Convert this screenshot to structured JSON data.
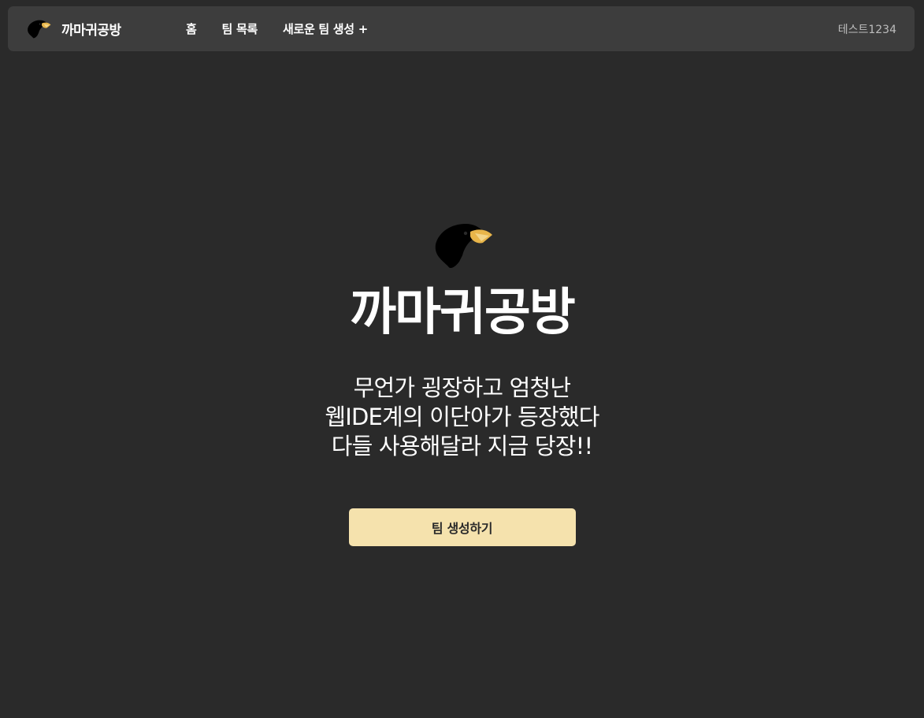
{
  "navbar": {
    "brand_name": "까마귀공방",
    "logo_icon": "crow-icon",
    "links": [
      {
        "label": "홈"
      },
      {
        "label": "팀 목록"
      },
      {
        "label": "새로운 팀 생성 +"
      }
    ],
    "user_name": "테스트1234"
  },
  "hero": {
    "logo_icon": "crow-icon",
    "title": "까마귀공방",
    "subtitle_lines": [
      "무언가 굉장하고 엄청난",
      "웹IDE계의 이단아가 등장했다",
      "다들 사용해달라 지금 당장!!"
    ],
    "cta_label": "팀 생성하기"
  },
  "colors": {
    "background": "#2a2a2a",
    "navbar": "#3d3d3d",
    "accent": "#f5e2ad",
    "muted_text": "#bdbdbd"
  }
}
